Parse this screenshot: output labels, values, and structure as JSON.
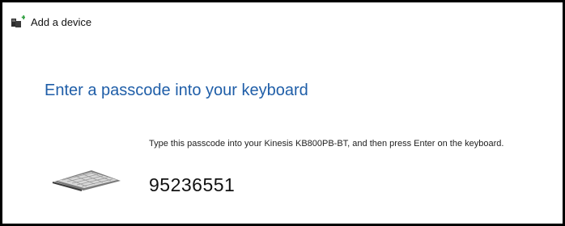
{
  "window": {
    "title": "Add a device",
    "title_icon": "add-device-icon"
  },
  "main": {
    "heading": "Enter a passcode into your keyboard",
    "instruction": "Type this passcode into your Kinesis KB800PB-BT, and then press Enter on the keyboard.",
    "passcode": "95236551",
    "device_icon": "keyboard-icon"
  },
  "colors": {
    "heading": "#1f5ea8",
    "border": "#000000",
    "icon_green": "#2e9e3e"
  }
}
